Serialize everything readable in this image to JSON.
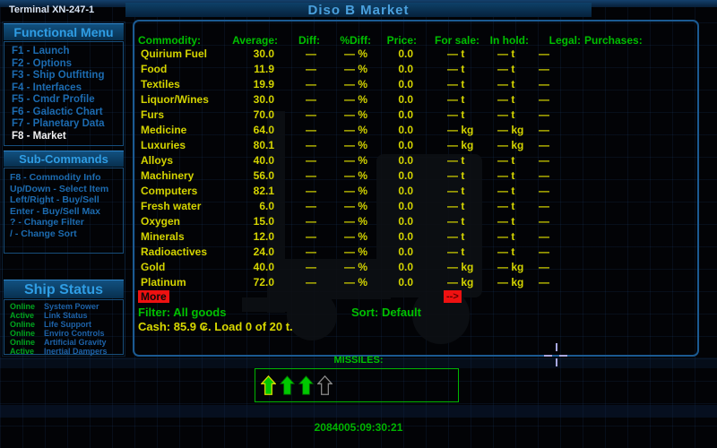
{
  "terminal": {
    "label": "Terminal XN-247-1"
  },
  "title": "Diso B Market",
  "colors": {
    "accent_blue": "#4aa0dd",
    "menu_blue": "#1c6bb0",
    "text_green": "#00c000",
    "text_yellow": "#d8d800",
    "alert_red": "#ee1111",
    "status_green": "#00a51e"
  },
  "functional_menu": {
    "title": "Functional Menu",
    "items": [
      {
        "label": "F1 - Launch",
        "state": "normal"
      },
      {
        "label": "F2 - Options",
        "state": "normal"
      },
      {
        "label": "F3 - Ship Outfitting",
        "state": "normal"
      },
      {
        "label": "F4 - Interfaces",
        "state": "normal"
      },
      {
        "label": "F5 - Cmdr Profile",
        "state": "normal"
      },
      {
        "label": "F6 - Galactic Chart",
        "state": "normal"
      },
      {
        "label": "F7 - Planetary Data",
        "state": "normal"
      },
      {
        "label": "F8 - Market",
        "state": "active"
      }
    ]
  },
  "sub_commands": {
    "title": "Sub-Commands",
    "items": [
      {
        "label": "F8 - Commodity Info"
      },
      {
        "label": "Up/Down - Select Item"
      },
      {
        "label": "Left/Right - Buy/Sell"
      },
      {
        "label": "Enter - Buy/Sell Max"
      },
      {
        "label": "? - Change Filter"
      },
      {
        "label": "/ - Change Sort"
      }
    ]
  },
  "ship_status": {
    "title": "Ship Status",
    "rows": [
      {
        "status": "Online",
        "system": "System Power"
      },
      {
        "status": "Active",
        "system": "Link Status"
      },
      {
        "status": "Online",
        "system": "Life Support"
      },
      {
        "status": "Online",
        "system": "Enviro Controls"
      },
      {
        "status": "Online",
        "system": "Artificial Gravity"
      },
      {
        "status": "Active",
        "system": "Inertial Dampers"
      }
    ]
  },
  "market": {
    "columns": [
      "Commodity:",
      "Average:",
      "Diff:",
      "%Diff:",
      "Price:",
      "For sale:",
      "In hold:",
      "Legal:",
      "Purchases:"
    ],
    "rows": [
      {
        "name": "Quirium Fuel",
        "average": "30.0",
        "diff": "—",
        "pdiff": "— %",
        "price": "0.0",
        "for_sale": "— t",
        "in_hold": "— t",
        "legal": "—",
        "purchases": ""
      },
      {
        "name": "Food",
        "average": "11.9",
        "diff": "—",
        "pdiff": "— %",
        "price": "0.0",
        "for_sale": "— t",
        "in_hold": "— t",
        "legal": "—",
        "purchases": ""
      },
      {
        "name": "Textiles",
        "average": "19.9",
        "diff": "—",
        "pdiff": "— %",
        "price": "0.0",
        "for_sale": "— t",
        "in_hold": "— t",
        "legal": "—",
        "purchases": ""
      },
      {
        "name": "Liquor/Wines",
        "average": "30.0",
        "diff": "—",
        "pdiff": "— %",
        "price": "0.0",
        "for_sale": "— t",
        "in_hold": "— t",
        "legal": "—",
        "purchases": ""
      },
      {
        "name": "Furs",
        "average": "70.0",
        "diff": "—",
        "pdiff": "— %",
        "price": "0.0",
        "for_sale": "— t",
        "in_hold": "— t",
        "legal": "—",
        "purchases": ""
      },
      {
        "name": "Medicine",
        "average": "64.0",
        "diff": "—",
        "pdiff": "— %",
        "price": "0.0",
        "for_sale": "— kg",
        "in_hold": "— kg",
        "legal": "—",
        "purchases": ""
      },
      {
        "name": "Luxuries",
        "average": "80.1",
        "diff": "—",
        "pdiff": "— %",
        "price": "0.0",
        "for_sale": "— kg",
        "in_hold": "— kg",
        "legal": "—",
        "purchases": ""
      },
      {
        "name": "Alloys",
        "average": "40.0",
        "diff": "—",
        "pdiff": "— %",
        "price": "0.0",
        "for_sale": "— t",
        "in_hold": "— t",
        "legal": "—",
        "purchases": ""
      },
      {
        "name": "Machinery",
        "average": "56.0",
        "diff": "—",
        "pdiff": "— %",
        "price": "0.0",
        "for_sale": "— t",
        "in_hold": "— t",
        "legal": "—",
        "purchases": ""
      },
      {
        "name": "Computers",
        "average": "82.1",
        "diff": "—",
        "pdiff": "— %",
        "price": "0.0",
        "for_sale": "— t",
        "in_hold": "— t",
        "legal": "—",
        "purchases": ""
      },
      {
        "name": "Fresh water",
        "average": "6.0",
        "diff": "—",
        "pdiff": "— %",
        "price": "0.0",
        "for_sale": "— t",
        "in_hold": "— t",
        "legal": "—",
        "purchases": ""
      },
      {
        "name": "Oxygen",
        "average": "15.0",
        "diff": "—",
        "pdiff": "— %",
        "price": "0.0",
        "for_sale": "— t",
        "in_hold": "— t",
        "legal": "—",
        "purchases": ""
      },
      {
        "name": "Minerals",
        "average": "12.0",
        "diff": "—",
        "pdiff": "— %",
        "price": "0.0",
        "for_sale": "— t",
        "in_hold": "— t",
        "legal": "—",
        "purchases": ""
      },
      {
        "name": "Radioactives",
        "average": "24.0",
        "diff": "—",
        "pdiff": "— %",
        "price": "0.0",
        "for_sale": "— t",
        "in_hold": "— t",
        "legal": "—",
        "purchases": ""
      },
      {
        "name": "Gold",
        "average": "40.0",
        "diff": "—",
        "pdiff": "— %",
        "price": "0.0",
        "for_sale": "— kg",
        "in_hold": "— kg",
        "legal": "—",
        "purchases": ""
      },
      {
        "name": "Platinum",
        "average": "72.0",
        "diff": "—",
        "pdiff": "— %",
        "price": "0.0",
        "for_sale": "— kg",
        "in_hold": "— kg",
        "legal": "—",
        "purchases": ""
      }
    ],
    "more_label": "More",
    "next_label": "-->",
    "filter": "Filter: All goods",
    "sort": "Sort: Default",
    "cash": "Cash: 85.9 ₢. Load 0 of 20 t."
  },
  "missiles": {
    "label": "MISSILES:",
    "slots": [
      {
        "state": "selected"
      },
      {
        "state": "filled"
      },
      {
        "state": "filled"
      },
      {
        "state": "empty"
      }
    ]
  },
  "clock": "2084005:09:30:21"
}
